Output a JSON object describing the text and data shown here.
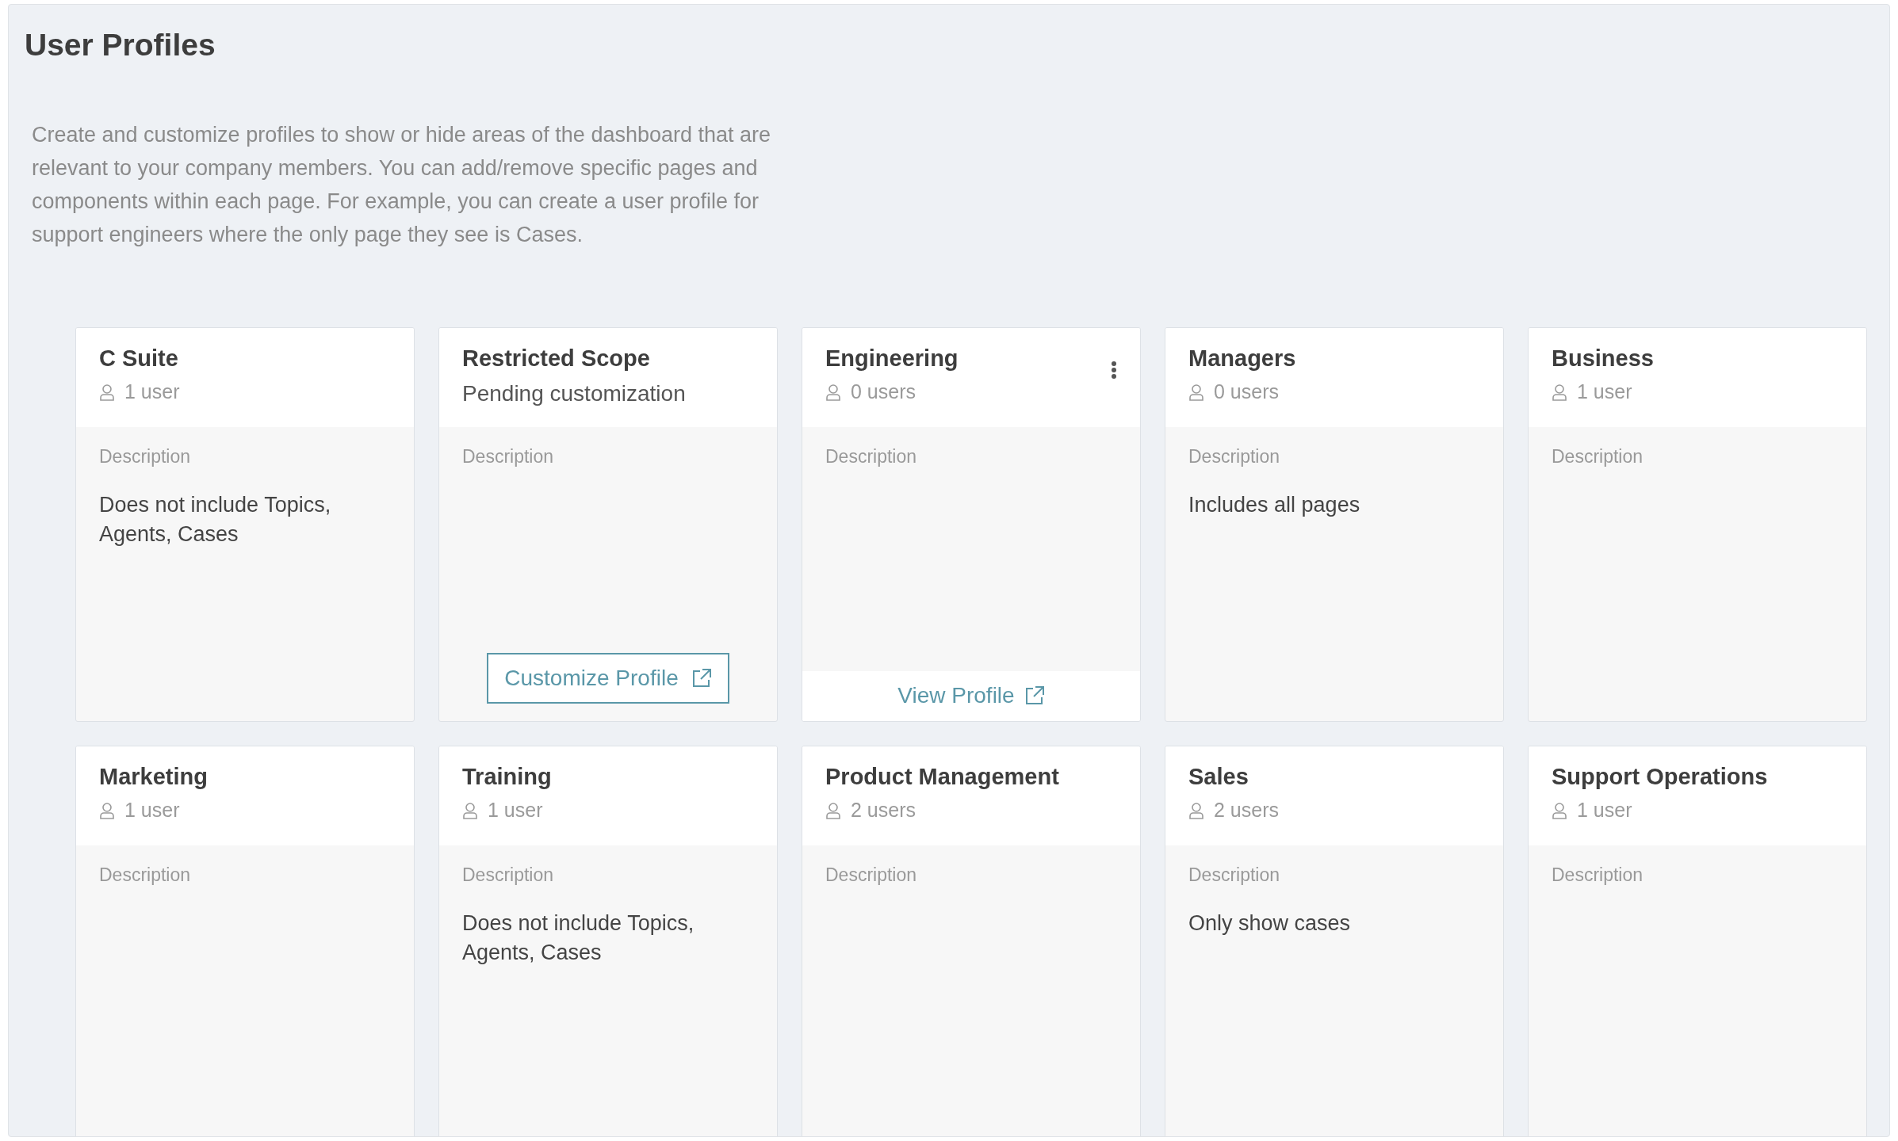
{
  "page": {
    "title": "User Profiles",
    "intro": "Create and customize profiles to show or hide areas of the dashboard that are relevant to your company members. You can add/remove specific pages and components within each page. For example, you can create a user profile for support engineers where the only page they see is Cases."
  },
  "profiles": [
    {
      "name": "C Suite",
      "kind": "users",
      "subtitle": "1 user",
      "description_label": "Description",
      "description": "Does not include Topics, Agents, Cases"
    },
    {
      "name": "Restricted Scope",
      "kind": "status",
      "subtitle": "Pending customization",
      "description_label": "Description",
      "footer": {
        "kind": "button",
        "label": "Customize Profile"
      }
    },
    {
      "name": "Engineering",
      "kind": "users",
      "subtitle": "0 users",
      "has_menu": true,
      "description_label": "Description",
      "footer": {
        "kind": "link",
        "label": "View Profile"
      }
    },
    {
      "name": "Managers",
      "kind": "users",
      "subtitle": "0 users",
      "description_label": "Description",
      "description": "Includes all pages"
    },
    {
      "name": "Business",
      "kind": "users",
      "subtitle": "1 user",
      "description_label": "Description"
    },
    {
      "name": "Marketing",
      "kind": "users",
      "subtitle": "1 user",
      "description_label": "Description"
    },
    {
      "name": "Training",
      "kind": "users",
      "subtitle": "1 user",
      "description_label": "Description",
      "description": "Does not include Topics, Agents, Cases"
    },
    {
      "name": "Product Management",
      "kind": "users",
      "subtitle": "2 users",
      "description_label": "Description"
    },
    {
      "name": "Sales",
      "kind": "users",
      "subtitle": "2 users",
      "description_label": "Description",
      "description": "Only show cases"
    },
    {
      "name": "Support Operations",
      "kind": "users",
      "subtitle": "1 user",
      "description_label": "Description"
    }
  ]
}
